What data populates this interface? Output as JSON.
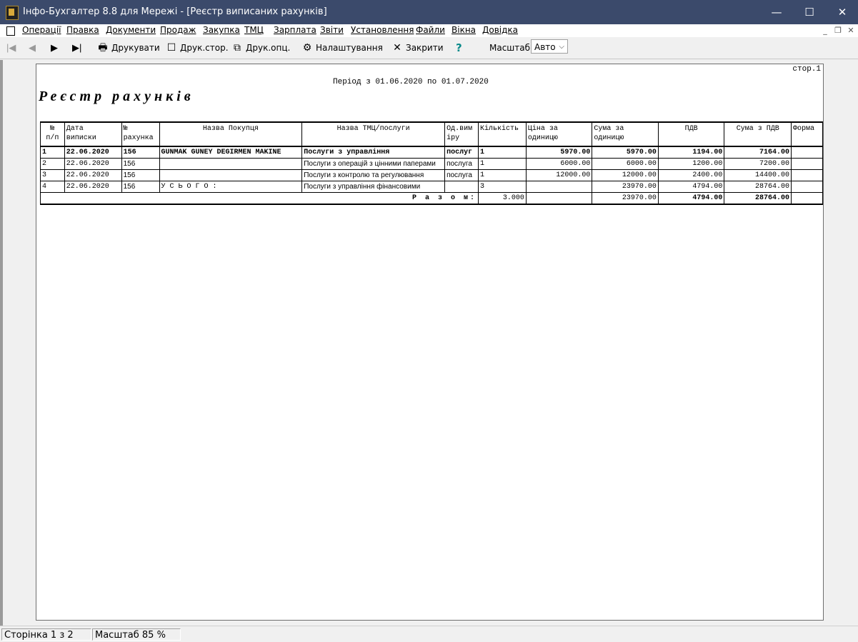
{
  "window": {
    "title": "Інфо-Бухгалтер 8.8 для Мережі - [Реєстр  виписаних  рахунків]",
    "minimize": "—",
    "maximize": "☐",
    "close": "✕"
  },
  "menu": {
    "items": [
      "Операції",
      "Правка",
      "Документи",
      "Продаж",
      "Закупка",
      "ТМЦ",
      "Зарплата",
      "Звіти",
      "Установлення",
      "Файли",
      "Вікна",
      "Довідка"
    ],
    "mdi_min": "_",
    "mdi_restore": "❐",
    "mdi_close": "✕"
  },
  "toolbar": {
    "first_icon": "first-page-icon",
    "prev_icon": "prev-page-icon",
    "next_icon": "next-page-icon",
    "last_icon": "last-page-icon",
    "print": "Друкувати",
    "print_page": "Друк.стор.",
    "print_options": "Друк.опц.",
    "settings": "Налаштування",
    "close": "Закрити",
    "help": "?",
    "zoom_label": "Масштаб:",
    "zoom_value": "Авто"
  },
  "report": {
    "page_label": "стор.1",
    "period": "Період з 01.06.2020 по 01.07.2020",
    "title": "Реєстр рахунків",
    "headers": {
      "num": "№\nп/п",
      "date": "Дата\nвиписки",
      "invoice": "№\nрахунка",
      "buyer": "Назва Покупця",
      "goods": "Назва ТМЦ/послуги",
      "unit": "Од.вим\nіру",
      "qty": "Кількість",
      "price": "Ціна за\nодиницю",
      "sum": "Сума за\nодиницю",
      "vat": "ПДВ",
      "sum_vat": "Сума з ПДВ",
      "form": "Форма"
    },
    "rows": [
      {
        "num": "1",
        "date": "22.06.2020",
        "invoice": "156",
        "buyer": "GUNMAK GUNEY DEGIRMEN MAKINE",
        "goods": "Послуги з управління",
        "unit": "послуг",
        "qty": "1",
        "price": "5970.00",
        "sum": "5970.00",
        "vat": "1194.00",
        "sum_vat": "7164.00"
      },
      {
        "num": "2",
        "date": "22.06.2020",
        "invoice": "156",
        "buyer": "",
        "goods": "Послуги з операцій з цінними паперами",
        "unit": "послуга",
        "qty": "1",
        "price": "6000.00",
        "sum": "6000.00",
        "vat": "1200.00",
        "sum_vat": "7200.00"
      },
      {
        "num": "3",
        "date": "22.06.2020",
        "invoice": "156",
        "buyer": "",
        "goods": "Послуги з контролю та регулювання",
        "unit": "послуга",
        "qty": "1",
        "price": "12000.00",
        "sum": "12000.00",
        "vat": "2400.00",
        "sum_vat": "14400.00"
      },
      {
        "num": "4",
        "date": "22.06.2020",
        "invoice": "156",
        "buyer": "У С Ь О Г О :",
        "goods": "Послуги з управління фінансовими",
        "unit": "",
        "qty": "3",
        "price": "",
        "sum": "23970.00",
        "vat": "4794.00",
        "sum_vat": "28764.00"
      }
    ],
    "total": {
      "label": "Р а з о м:",
      "qty": "3.000",
      "sum": "23970.00",
      "vat": "4794.00",
      "sum_vat": "28764.00"
    }
  },
  "status": {
    "page": "Сторінка 1 з 2",
    "zoom": "Масштаб 85 %"
  }
}
